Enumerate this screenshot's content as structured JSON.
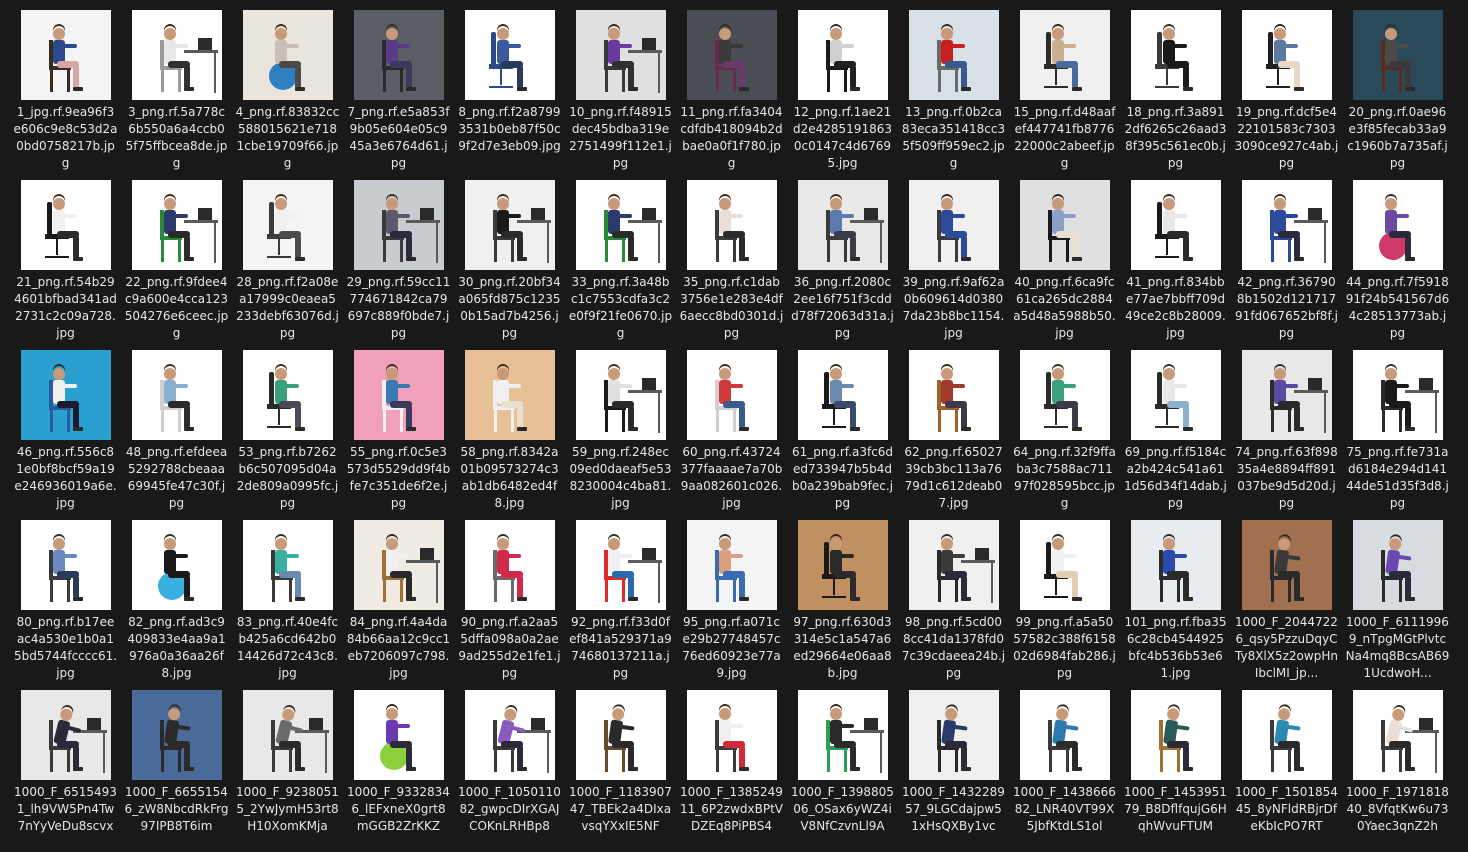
{
  "files": [
    {
      "name": "1_jpg.rf.9ea96f3e606c9e8c53d2a0bd0758217b.jpg",
      "bg": "#f4f4f4",
      "shirt": "#2b4a8a",
      "pants": "#d9a5a5",
      "chair": "#3a2a22",
      "pose": "sit"
    },
    {
      "name": "3_png.rf.5a778c6b550a6a4ccb05f75ffbcea8de.jpg",
      "bg": "#ffffff",
      "shirt": "#e8e8e8",
      "pants": "#303030",
      "chair": "#9a9a9a",
      "pose": "desk"
    },
    {
      "name": "4_png.rf.83832cc588015621e7181cbe19709f66.jpg",
      "bg": "#e9e4dc",
      "shirt": "#c8c0b8",
      "pants": "#4a4a4a",
      "chair": "#2f7fc0",
      "pose": "ball"
    },
    {
      "name": "7_png.rf.e5a853f9b05e604e05c945a3e6764d61.jpg",
      "bg": "#5a5e64",
      "shirt": "#5b3a8a",
      "pants": "#3a3a5a",
      "chair": "#2a2a2a",
      "pose": "sit"
    },
    {
      "name": "8_png.rf.f2a87993531b0eb87f50c9f2d7e3eb09.jpg",
      "bg": "#ffffff",
      "shirt": "#3a5aa0",
      "pants": "#2a3a5a",
      "chair": "#2a4a8a",
      "pose": "office"
    },
    {
      "name": "10_png.rf.f48915dec45bdba319e2751499f112e1.jpg",
      "bg": "#e0e0e0",
      "shirt": "#6a3aa0",
      "pants": "#303030",
      "chair": "#3a3a3a",
      "pose": "desk"
    },
    {
      "name": "11_png.rf.fa3404cdfdb418094b2dbae0a0f1f780.jpg",
      "bg": "#4a4e54",
      "shirt": "#3a3a3a",
      "pants": "#6a3a6a",
      "chair": "#6a2a4a",
      "pose": "sit"
    },
    {
      "name": "12_png.rf.1ae21d2e42851918630c0147c4d67695.jpg",
      "bg": "#ffffff",
      "shirt": "#d0d0d0",
      "pants": "#202020",
      "chair": "#1a1a1a",
      "pose": "sit"
    },
    {
      "name": "13_png.rf.0b2ca83eca351418cc35f509ff959ec2.jpg",
      "bg": "#d8e0e8",
      "shirt": "#c82020",
      "pants": "#3a5a8a",
      "chair": "#6a6a6a",
      "pose": "sit"
    },
    {
      "name": "15_png.rf.d48aafef447741fb877622000c2abeef.jpg",
      "bg": "#f0f0f0",
      "shirt": "#c8b090",
      "pants": "#4a6a9a",
      "chair": "#2a2a2a",
      "pose": "office"
    },
    {
      "name": "18_png.rf.3a8912df6265c26aad38f395c561ec0b.jpg",
      "bg": "#ffffff",
      "shirt": "#1a1a1a",
      "pants": "#1a1a1a",
      "chair": "#3a3a3a",
      "pose": "office"
    },
    {
      "name": "19_png.rf.dcf5e422101583c73033090ce927c4ab.jpg",
      "bg": "#ffffff",
      "shirt": "#5a7aa0",
      "pants": "#e8d8c8",
      "chair": "#202020",
      "pose": "office"
    },
    {
      "name": "20_png.rf.0ae96e3f85fecab33a9c1960b7a735af.jpg",
      "bg": "#2a4a5a",
      "shirt": "#4a4a4a",
      "pants": "#3a3a3a",
      "chair": "#5a2a1a",
      "pose": "sit"
    },
    {
      "name": "21_png.rf.54b294601bfbad341ad2731c2c09a728.jpg",
      "bg": "#ffffff",
      "shirt": "#f0f0f0",
      "pants": "#2a2a2a",
      "chair": "#1a1a1a",
      "pose": "office"
    },
    {
      "name": "22_png.rf.9fdee4c9a600e4cca123504276e6ceec.jpg",
      "bg": "#ffffff",
      "shirt": "#2a3a6a",
      "pants": "#2a2a2a",
      "chair": "#2a8a3a",
      "pose": "desk"
    },
    {
      "name": "28_png.rf.f2a08ea17999c0eaea5233debf63076d.jpg",
      "bg": "#f4f4f4",
      "shirt": "#f0f0f0",
      "pants": "#4a4a4a",
      "chair": "#3a3a3a",
      "pose": "office"
    },
    {
      "name": "29_png.rf.59cc11774671842ca79697c889f0bde7.jpg",
      "bg": "#c8ccd0",
      "shirt": "#5a5a6a",
      "pants": "#2a2a3a",
      "chair": "#3a3a3a",
      "pose": "desk"
    },
    {
      "name": "30_png.rf.20bf34a065fd875c12350b15ad7b4256.jpg",
      "bg": "#f0f0f0",
      "shirt": "#1a1a1a",
      "pants": "#2a2a2a",
      "chair": "#3a3a3a",
      "pose": "desk"
    },
    {
      "name": "33_png.rf.3a48bc1c7553cdfa3c2e0f9f21fe0670.jpg",
      "bg": "#ffffff",
      "shirt": "#2a3a6a",
      "pants": "#2a2a2a",
      "chair": "#2a8a3a",
      "pose": "desk"
    },
    {
      "name": "35_png.rf.c1dab3756e1e283e4df6aecc8bd0301d.jpg",
      "bg": "#ffffff",
      "shirt": "#e8e0d8",
      "pants": "#2a2a2a",
      "chair": "#3a3a3a",
      "pose": "sit"
    },
    {
      "name": "36_png.rf.2080c2ee16f751f3cddd78f72063d31a.jpg",
      "bg": "#e8e8e8",
      "shirt": "#5a7ab0",
      "pants": "#3a3a4a",
      "chair": "#3a3a3a",
      "pose": "desk"
    },
    {
      "name": "39_png.rf.9af62a0b609614d03807da23b8bc1154.jpg",
      "bg": "#f0f0f0",
      "shirt": "#2a4a9a",
      "pants": "#2a4a9a",
      "chair": "#3a3a3a",
      "pose": "sit"
    },
    {
      "name": "40_png.rf.6ca9fc61ca265dc2884a5d48a5988b50.jpg",
      "bg": "#e0e0e0",
      "shirt": "#8aa0c8",
      "pants": "#e8e0d0",
      "chair": "#1a1a1a",
      "pose": "sit"
    },
    {
      "name": "41_png.rf.834bbe77ae7bbff709d49ce2c8b28009.jpg",
      "bg": "#ffffff",
      "shirt": "#e8e8e8",
      "pants": "#2a2a2a",
      "chair": "#1a1a1a",
      "pose": "office"
    },
    {
      "name": "42_png.rf.367908b1502d12171791fd067652bf8f.jpg",
      "bg": "#ffffff",
      "shirt": "#2a4a9a",
      "pants": "#2a2a3a",
      "chair": "#2a4a9a",
      "pose": "desk"
    },
    {
      "name": "44_png.rf.7f591891f24b541567d64c28513773ab.jpg",
      "bg": "#ffffff",
      "shirt": "#6a4aa0",
      "pants": "#2a2a3a",
      "chair": "#d03a6a",
      "pose": "ball"
    },
    {
      "name": "46_png.rf.556c81e0bf8bcf59a19e246936019a6e.jpg",
      "bg": "#2aa0d0",
      "shirt": "#f0f0f0",
      "pants": "#1a1a2a",
      "chair": "#2a5aa0",
      "pose": "sit"
    },
    {
      "name": "48_png.rf.efdeea5292788cbeaaa69945fe47c30f.jpg",
      "bg": "#ffffff",
      "shirt": "#8ab0d0",
      "pants": "#2a2a2a",
      "chair": "#d0d0d0",
      "pose": "sit"
    },
    {
      "name": "53_png.rf.b7262b6c507095d04a2de809a0995fc.jpg",
      "bg": "#ffffff",
      "shirt": "#3aa080",
      "pants": "#4a4a5a",
      "chair": "#2a2a2a",
      "pose": "office"
    },
    {
      "name": "55_png.rf.0c5e3573d5529dd9f4bfe7c351de6f2e.jpg",
      "bg": "#f0a0b8",
      "shirt": "#3a7ab0",
      "pants": "#3a3a5a",
      "chair": "#f0f0f0",
      "pose": "sit"
    },
    {
      "name": "58_png.rf.8342a01b09573274c3ab1db6482ed4f8.jpg",
      "bg": "#e8c098",
      "shirt": "#f0f0f0",
      "pants": "#e8e0d0",
      "chair": "#f0f0f0",
      "pose": "sit"
    },
    {
      "name": "59_png.rf.248ec09ed0daeaf5e538230004c4ba81.jpg",
      "bg": "#ffffff",
      "shirt": "#e0e0e0",
      "pants": "#2a2a2a",
      "chair": "#1a1a1a",
      "pose": "desk"
    },
    {
      "name": "60_png.rf.43724377faaaae7a70b9aa082601c026.jpg",
      "bg": "#ffffff",
      "shirt": "#d03a3a",
      "pants": "#3a5a8a",
      "chair": "#d0d0d0",
      "pose": "sit"
    },
    {
      "name": "61_png.rf.a3fc6ded733947b5b4db0a239bab9fec.jpg",
      "bg": "#ffffff",
      "shirt": "#6a8ab0",
      "pants": "#3a4a6a",
      "chair": "#1a1a1a",
      "pose": "office"
    },
    {
      "name": "62_png.rf.6502739cb3bc113a7679d1c612deab07.jpg",
      "bg": "#ffffff",
      "shirt": "#a03a2a",
      "pants": "#3a3a4a",
      "chair": "#a0602a",
      "pose": "sit"
    },
    {
      "name": "64_png.rf.32f9ffaba3c7588ac71197f028595bcc.jpg",
      "bg": "#ffffff",
      "shirt": "#3aa080",
      "pants": "#3a3a4a",
      "chair": "#2a2a2a",
      "pose": "office"
    },
    {
      "name": "69_png.rf.f5184ca2b424c541a611d56d34f14dab.jpg",
      "bg": "#ffffff",
      "shirt": "#e8e8e8",
      "pants": "#8ab0d0",
      "chair": "#2a2a2a",
      "pose": "office"
    },
    {
      "name": "74_png.rf.63f89835a4e8894ff891037be9d5d20d.jpg",
      "bg": "#e8e8e8",
      "shirt": "#5a4aa0",
      "pants": "#2a2a2a",
      "chair": "#2a2a2a",
      "pose": "desk"
    },
    {
      "name": "75_png.rf.fe731ad6184e294d14144de51d35f3d8.jpg",
      "bg": "#ffffff",
      "shirt": "#1a1a1a",
      "pants": "#1a1a1a",
      "chair": "#2a2a2a",
      "pose": "desk"
    },
    {
      "name": "80_png.rf.b17eeac4a530e1b0a15bd5744fcccc61.jpg",
      "bg": "#ffffff",
      "shirt": "#6a8ac0",
      "pants": "#2a3a5a",
      "chair": "#3a3a3a",
      "pose": "sit"
    },
    {
      "name": "82_png.rf.ad3c9409833e4aa9a1976a0a36aa26f8.jpg",
      "bg": "#ffffff",
      "shirt": "#1a1a1a",
      "pants": "#1a1a1a",
      "chair": "#3ab0e0",
      "pose": "ball"
    },
    {
      "name": "83_png.rf.40e4fcb425a6cd642b014426d72c43c8.jpg",
      "bg": "#ffffff",
      "shirt": "#3ab0a0",
      "pants": "#6a8ab0",
      "chair": "#3a3a3a",
      "pose": "sit"
    },
    {
      "name": "84_png.rf.4a4da84b66aa12c9cc1eb7206097c798.jpg",
      "bg": "#f0ece4",
      "shirt": "#f0f0f0",
      "pants": "#2a2a2a",
      "chair": "#a0703a",
      "pose": "desk"
    },
    {
      "name": "90_png.rf.a2aa55dffa098a0a2ae9ad255d2e1fe1.jpg",
      "bg": "#ffffff",
      "shirt": "#d02a4a",
      "pants": "#d02a4a",
      "chair": "#6a6a6a",
      "pose": "sit"
    },
    {
      "name": "92_png.rf.f33d0fef841a529371a974680137211a.jpg",
      "bg": "#ffffff",
      "shirt": "#f0f0f0",
      "pants": "#2a6ab0",
      "chair": "#e02a2a",
      "pose": "desk"
    },
    {
      "name": "95_png.rf.a071ce29b27748457c76ed60923e77a9.jpg",
      "bg": "#f4f4f4",
      "shirt": "#d8a080",
      "pants": "#3a6ab0",
      "chair": "#3a6ab0",
      "pose": "sit"
    },
    {
      "name": "97_png.rf.630d3314e5c1a547a6ed29664e06aa8b.jpg",
      "bg": "#c09060",
      "shirt": "#2a2a2a",
      "pants": "#2a2a2a",
      "chair": "#1a1a1a",
      "pose": "office"
    },
    {
      "name": "98_png.rf.5cd008cc41da1378fd07c39cdaeea24b.jpg",
      "bg": "#f0f0f0",
      "shirt": "#3a3a3a",
      "pants": "#2a2a3a",
      "chair": "#2a2a2a",
      "pose": "desk"
    },
    {
      "name": "99_png.rf.a5a5057582c388f615802d6984fab286.jpg",
      "bg": "#ffffff",
      "shirt": "#f0f0f0",
      "pants": "#e0d0b0",
      "chair": "#1a1a1a",
      "pose": "office"
    },
    {
      "name": "101_png.rf.fba356c28cb4544925bfc4b536b53e61.jpg",
      "bg": "#e8ecf0",
      "shirt": "#2a4ab0",
      "pants": "#2a2a2a",
      "chair": "#2a2a2a",
      "pose": "sit"
    },
    {
      "name": "1000_F_20447226_qsy5PzzuDqyCTy8XlX5z2owpHnIbclMI_jp...",
      "bg": "#a07050",
      "shirt": "#3a3a3a",
      "pants": "#2a2a2a",
      "chair": "#2a2a2a",
      "pose": "slouch"
    },
    {
      "name": "1000_F_61119969_nTpgMGtPlvtcNa4mq8BcsAB691UcdwoH...",
      "bg": "#d8dce0",
      "shirt": "#6a4ab0",
      "pants": "#2a2a3a",
      "chair": "#2a2a2a",
      "pose": "slouch"
    },
    {
      "name": "1000_F_65154931_lh9VW5Pn4Tw7nYyVeDu8scvx",
      "bg": "#e8e8e8",
      "shirt": "#2a2a3a",
      "pants": "#2a2a3a",
      "chair": "#3a3a3a",
      "pose": "lean"
    },
    {
      "name": "1000_F_66551546_zW8NbcdRkFrg97IPB8T6im",
      "bg": "#4a6a9a",
      "shirt": "#2a2a2a",
      "pants": "#2a2a2a",
      "chair": "#2a2a2a",
      "pose": "slouch"
    },
    {
      "name": "1000_F_92380515_2YwJymH53rt8H10XomKMja",
      "bg": "#e8e8e8",
      "shirt": "#6a6a6a",
      "pants": "#2a2a2a",
      "chair": "#3a3a3a",
      "pose": "lean"
    },
    {
      "name": "1000_F_93328346_lEFxneX0grt8mGGB2ZrKKZ",
      "bg": "#ffffff",
      "shirt": "#6a3ab0",
      "pants": "#2a2a3a",
      "chair": "#8ad03a",
      "pose": "ball"
    },
    {
      "name": "1000_F_105011082_gwpcDIrXGAJCOKnLRHBp8",
      "bg": "#ffffff",
      "shirt": "#8a5ac0",
      "pants": "#2a2a3a",
      "chair": "#3a3a3a",
      "pose": "lean"
    },
    {
      "name": "1000_F_118390747_TBEk2a4DIxavsqYXxIE5NF",
      "bg": "#ffffff",
      "shirt": "#2a2a2a",
      "pants": "#2a2a2a",
      "chair": "#6a4a2a",
      "pose": "slouch"
    },
    {
      "name": "1000_F_138524911_6P2zwdxBPtVDZEq8PiPBS4",
      "bg": "#ffffff",
      "shirt": "#f0f0f0",
      "pants": "#d02a3a",
      "chair": "#3a3a3a",
      "pose": "sit"
    },
    {
      "name": "1000_F_139880506_OSax6yWZ4iV8NfCzvnLl9A",
      "bg": "#ffffff",
      "shirt": "#2a2a2a",
      "pants": "#2a2a2a",
      "chair": "#2aa05a",
      "pose": "desk"
    },
    {
      "name": "1000_F_143228957_9LGCdajpw51xHsQXBy1vc",
      "bg": "#f0f0f0",
      "shirt": "#2a3a6a",
      "pants": "#2a2a3a",
      "chair": "#2a2a2a",
      "pose": "slouch"
    },
    {
      "name": "1000_F_143866682_LNR40VT99X5JbfKtdLS1ol",
      "bg": "#ffffff",
      "shirt": "#2a7ab0",
      "pants": "#2a2a2a",
      "chair": "#3a3a3a",
      "pose": "slouch"
    },
    {
      "name": "1000_F_145395179_B8DflfqujG6HqhWvuFTUM",
      "bg": "#ffffff",
      "shirt": "#2a5a5a",
      "pants": "#2a2a3a",
      "chair": "#a07030",
      "pose": "slouch"
    },
    {
      "name": "1000_F_150185445_8yNFldRBjrDfeKbIcPO7RT",
      "bg": "#ffffff",
      "shirt": "#2a8ab0",
      "pants": "#2a2a2a",
      "chair": "#3a3a3a",
      "pose": "slouch"
    },
    {
      "name": "1000_F_197181840_8VfqtKw6u730Yaec3qnZ2h",
      "bg": "#ffffff",
      "shirt": "#e8e0d8",
      "pants": "#2a2a2a",
      "chair": "#3a3a3a",
      "pose": "lean"
    }
  ]
}
